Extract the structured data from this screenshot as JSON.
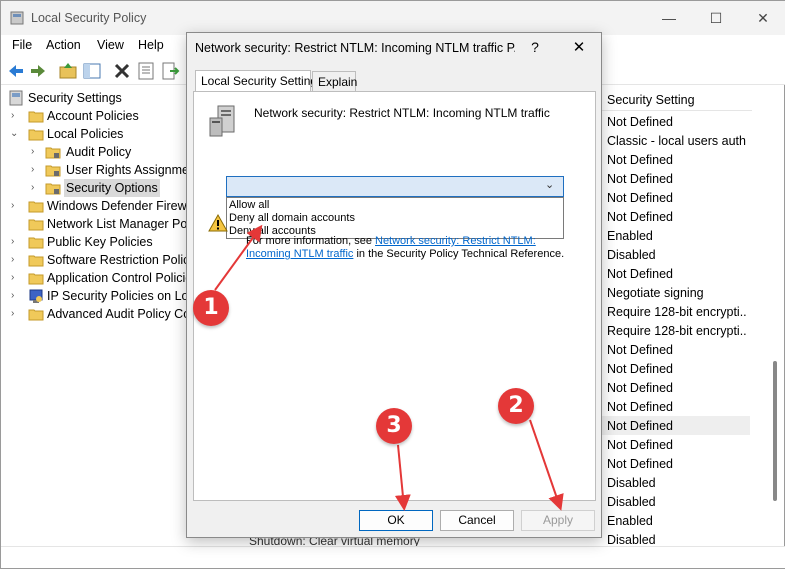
{
  "window": {
    "title": "Local Security Policy",
    "min": "—",
    "max": "☐",
    "close": "✕"
  },
  "menu": [
    "File",
    "Action",
    "View",
    "Help"
  ],
  "tree": {
    "root": "Security Settings",
    "items": [
      {
        "label": "Account Policies",
        "level": 1,
        "expanded": false
      },
      {
        "label": "Local Policies",
        "level": 1,
        "expanded": true
      },
      {
        "label": "Audit Policy",
        "level": 2,
        "expanded": false
      },
      {
        "label": "User Rights Assignment",
        "level": 2,
        "expanded": false
      },
      {
        "label": "Security Options",
        "level": 2,
        "expanded": false,
        "selected": true
      },
      {
        "label": "Windows Defender Firewall",
        "level": 1,
        "expanded": false
      },
      {
        "label": "Network List Manager Poli",
        "level": 1,
        "expanded": false
      },
      {
        "label": "Public Key Policies",
        "level": 1,
        "expanded": false
      },
      {
        "label": "Software Restriction Policie",
        "level": 1,
        "expanded": false
      },
      {
        "label": "Application Control Policie",
        "level": 1,
        "expanded": false
      },
      {
        "label": "IP Security Policies on Loca",
        "level": 1,
        "expanded": false
      },
      {
        "label": "Advanced Audit Policy Con",
        "level": 1,
        "expanded": false
      }
    ]
  },
  "list": {
    "header": "Security Setting",
    "values": [
      "Not Defined",
      "Classic - local users auth...",
      "Not Defined",
      "Not Defined",
      "Not Defined",
      "Not Defined",
      "Enabled",
      "Disabled",
      "Not Defined",
      "Negotiate signing",
      "Require 128-bit encrypti...",
      "Require 128-bit encrypti...",
      "Not Defined",
      "Not Defined",
      "Not Defined",
      "Not Defined",
      "Not Defined",
      "Not Defined",
      "Not Defined",
      "Disabled",
      "Disabled",
      "Enabled",
      "Disabled"
    ],
    "bottom_policy": "Shutdown: Clear virtual memory pagefile"
  },
  "dialog": {
    "title": "Network security: Restrict NTLM: Incoming NTLM traffic P...",
    "help": "?",
    "close": "✕",
    "tabs": [
      "Local Security Setting",
      "Explain"
    ],
    "policy_name": "Network security: Restrict NTLM: Incoming NTLM traffic",
    "combo_value": "",
    "options": [
      "Allow all",
      "Deny all domain accounts",
      "Deny all accounts"
    ],
    "info_prefix": "For more information, see ",
    "info_link": "Network security: Restrict NTLM: Incoming NTLM traffic",
    "info_suffix": " in the Security Policy Technical Reference.",
    "buttons": {
      "ok": "OK",
      "cancel": "Cancel",
      "apply": "Apply"
    }
  },
  "annotations": {
    "badge1": "1",
    "badge2": "2",
    "badge3": "3",
    "color": "#e43838"
  }
}
